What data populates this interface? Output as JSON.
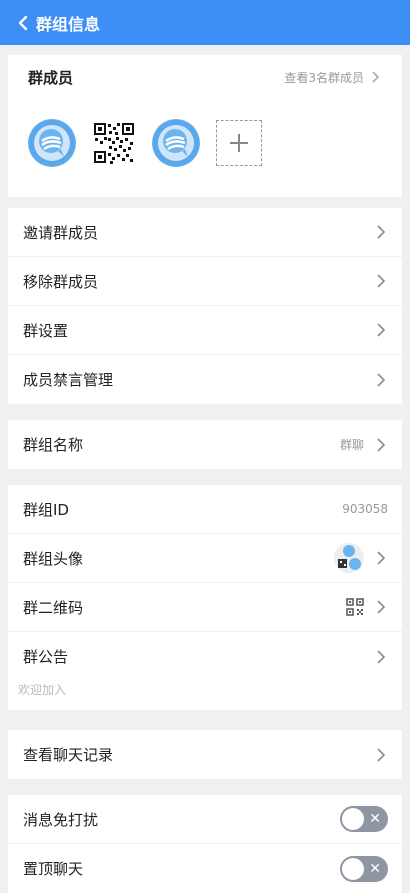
{
  "header": {
    "title": "群组信息"
  },
  "members": {
    "label": "群成员",
    "view_all": "查看3名群成员"
  },
  "menu1": [
    {
      "label": "邀请群成员"
    },
    {
      "label": "移除群成员"
    },
    {
      "label": "群设置"
    },
    {
      "label": "成员禁言管理"
    }
  ],
  "name_row": {
    "label": "群组名称",
    "value": "群聊"
  },
  "info": {
    "id_label": "群组ID",
    "id_value": "903058",
    "avatar_label": "群组头像",
    "qrcode_label": "群二维码",
    "notice_label": "群公告",
    "notice_text": "欢迎加入"
  },
  "history": {
    "label": "查看聊天记录"
  },
  "settings": [
    {
      "label": "消息免打扰",
      "on": false
    },
    {
      "label": "置顶聊天",
      "on": false
    }
  ],
  "colors": {
    "header": "#3d8ff5",
    "toggle_off": "#8e96a3"
  }
}
